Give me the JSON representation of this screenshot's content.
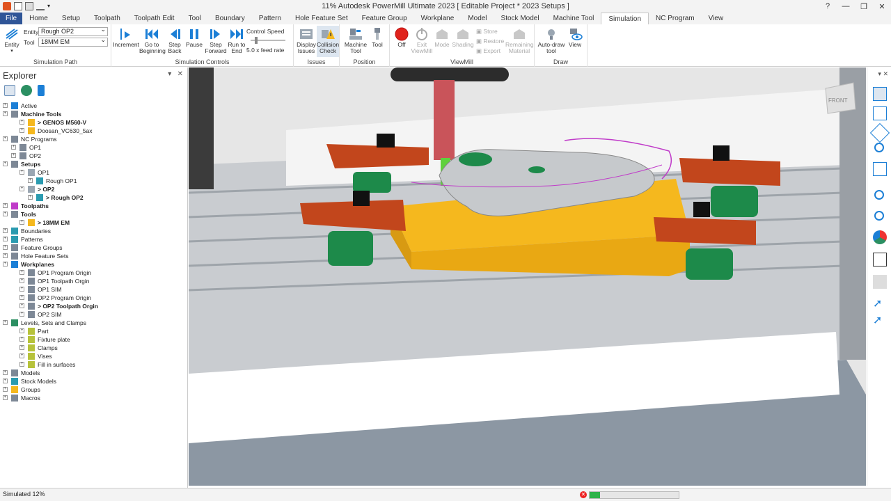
{
  "app": {
    "title": "11% Autodesk PowerMill Ultimate 2023   [ Editable Project * 2023 Setups ]"
  },
  "ribbon_tabs": [
    "File",
    "Home",
    "Setup",
    "Toolpath",
    "Toolpath Edit",
    "Tool",
    "Boundary",
    "Pattern",
    "Hole Feature Set",
    "Feature Group",
    "Workplane",
    "Model",
    "Stock Model",
    "Machine Tool",
    "Simulation",
    "NC Program",
    "View"
  ],
  "active_tab": "Simulation",
  "ribbon": {
    "simulation_path": {
      "label": "Simulation Path",
      "entity_btn": "Entity",
      "entity_field_label": "Entity",
      "entity_value": "Rough OP2",
      "tool_field_label": "Tool",
      "tool_value": "18MM EM"
    },
    "simulation_controls": {
      "label": "Simulation Controls",
      "increment": "Increment",
      "go_to_beginning": "Go to Beginning",
      "step_back": "Step Back",
      "pause": "Pause",
      "step_forward": "Step Forward",
      "run_to_end": "Run to End",
      "control_speed": "Control Speed",
      "feed_rate": "5.0 x feed rate"
    },
    "issues": {
      "label": "Issues",
      "display_issues": "Display Issues",
      "collision_check": "Collision Check"
    },
    "position": {
      "label": "Position",
      "machine_tool": "Machine Tool",
      "tool": "Tool"
    },
    "viewmill": {
      "label": "ViewMill",
      "off": "Off",
      "exit_viewmill": "Exit ViewMill",
      "mode": "Mode",
      "shading": "Shading",
      "store": "Store",
      "restore": "Restore",
      "export": "Export",
      "remaining_material": "Remaining Material"
    },
    "draw": {
      "label": "Draw",
      "auto_draw_tool": "Auto-draw tool",
      "view": "View"
    }
  },
  "explorer": {
    "title": "Explorer",
    "tree": [
      {
        "label": "Active",
        "indent": 0,
        "bold": false,
        "icon": "active-icon"
      },
      {
        "label": "Machine Tools",
        "indent": 0,
        "bold": true,
        "icon": "machine-tools-icon"
      },
      {
        "label": "> GENOS M560-V",
        "indent": 2,
        "bold": true,
        "icon": "machine-icon"
      },
      {
        "label": "Doosan_VC630_5ax",
        "indent": 2,
        "bold": false,
        "icon": "machine-icon"
      },
      {
        "label": "NC Programs",
        "indent": 0,
        "bold": false,
        "icon": "nc-programs-icon"
      },
      {
        "label": "OP1",
        "indent": 1,
        "bold": false,
        "icon": "nc-program-icon"
      },
      {
        "label": "OP2",
        "indent": 1,
        "bold": false,
        "icon": "nc-program-icon"
      },
      {
        "label": "Setups",
        "indent": 0,
        "bold": true,
        "icon": "setups-icon"
      },
      {
        "label": "OP1",
        "indent": 2,
        "bold": false,
        "icon": "setup-icon"
      },
      {
        "label": "Rough OP1",
        "indent": 3,
        "bold": false,
        "icon": "toolpath-icon"
      },
      {
        "label": "> OP2",
        "indent": 2,
        "bold": true,
        "icon": "setup-icon"
      },
      {
        "label": "> Rough OP2",
        "indent": 3,
        "bold": true,
        "icon": "toolpath-icon"
      },
      {
        "label": "Toolpaths",
        "indent": 0,
        "bold": true,
        "icon": "toolpaths-icon"
      },
      {
        "label": "Tools",
        "indent": 0,
        "bold": true,
        "icon": "tools-icon"
      },
      {
        "label": "> 18MM EM",
        "indent": 2,
        "bold": true,
        "icon": "tool-icon"
      },
      {
        "label": "Boundaries",
        "indent": 0,
        "bold": false,
        "icon": "boundaries-icon"
      },
      {
        "label": "Patterns",
        "indent": 0,
        "bold": false,
        "icon": "patterns-icon"
      },
      {
        "label": "Feature Groups",
        "indent": 0,
        "bold": false,
        "icon": "feature-groups-icon"
      },
      {
        "label": "Hole Feature Sets",
        "indent": 0,
        "bold": false,
        "icon": "hole-feature-sets-icon"
      },
      {
        "label": "Workplanes",
        "indent": 0,
        "bold": true,
        "icon": "workplanes-icon"
      },
      {
        "label": "OP1 Program Origin",
        "indent": 2,
        "bold": false,
        "icon": "workplane-icon"
      },
      {
        "label": "OP1 Toolpath Orgin",
        "indent": 2,
        "bold": false,
        "icon": "workplane-icon"
      },
      {
        "label": "OP1 SIM",
        "indent": 2,
        "bold": false,
        "icon": "workplane-icon"
      },
      {
        "label": "OP2 Program Origin",
        "indent": 2,
        "bold": false,
        "icon": "workplane-icon"
      },
      {
        "label": "> OP2 Toolpath Orgin",
        "indent": 2,
        "bold": true,
        "icon": "workplane-icon"
      },
      {
        "label": "OP2 SIM",
        "indent": 2,
        "bold": false,
        "icon": "workplane-icon"
      },
      {
        "label": "Levels, Sets and Clamps",
        "indent": 0,
        "bold": false,
        "icon": "levels-icon"
      },
      {
        "label": "Part",
        "indent": 2,
        "bold": false,
        "icon": "level-icon"
      },
      {
        "label": "Fixture plate",
        "indent": 2,
        "bold": false,
        "icon": "level-icon"
      },
      {
        "label": "Clamps",
        "indent": 2,
        "bold": false,
        "icon": "level-icon"
      },
      {
        "label": "Vises",
        "indent": 2,
        "bold": false,
        "icon": "level-icon"
      },
      {
        "label": "Fill in surfaces",
        "indent": 2,
        "bold": false,
        "icon": "level-icon"
      },
      {
        "label": "Models",
        "indent": 0,
        "bold": false,
        "icon": "models-icon"
      },
      {
        "label": "Stock Models",
        "indent": 0,
        "bold": false,
        "icon": "stock-models-icon"
      },
      {
        "label": "Groups",
        "indent": 0,
        "bold": false,
        "icon": "groups-icon"
      },
      {
        "label": "Macros",
        "indent": 0,
        "bold": false,
        "icon": "macros-icon"
      }
    ]
  },
  "viewcube_label": "FRONT",
  "status": {
    "text": "Simulated 12%",
    "progress": 0.12
  },
  "colors": {
    "file_tab": "#2f5597",
    "accent_blue": "#1c7fd6",
    "stock_orange": "#f5b81e",
    "clamp_red": "#c2461c",
    "nut_green": "#1d8a4a",
    "progress_green": "#2fb34a"
  }
}
